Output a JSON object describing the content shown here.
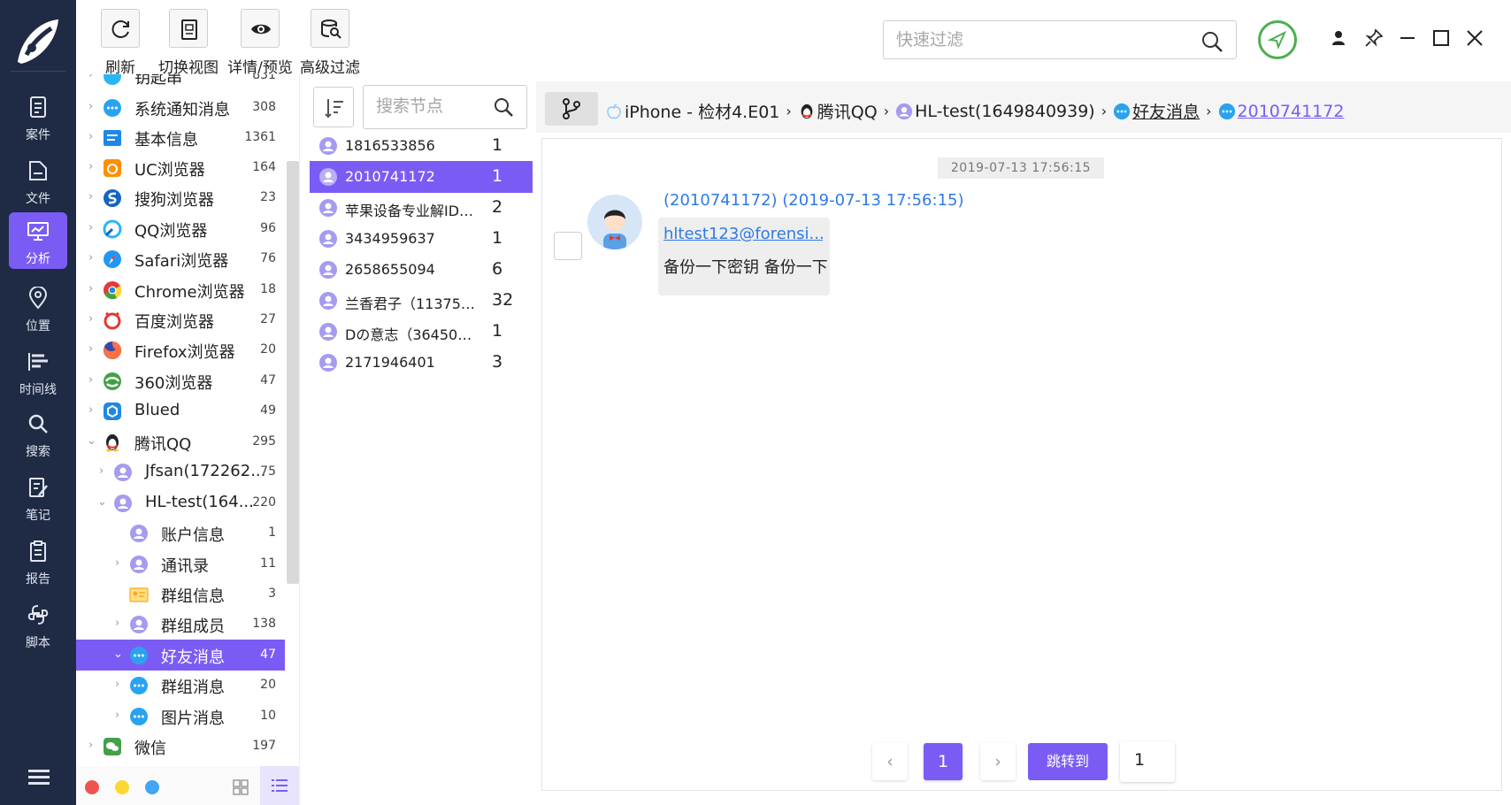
{
  "nav": [
    {
      "label": "案件",
      "icon": "case-icon"
    },
    {
      "label": "文件",
      "icon": "file-icon"
    },
    {
      "label": "分析",
      "icon": "analysis-icon",
      "active": true
    },
    {
      "label": "位置",
      "icon": "location-icon"
    },
    {
      "label": "时间线",
      "icon": "timeline-icon"
    },
    {
      "label": "搜索",
      "icon": "search-icon"
    },
    {
      "label": "笔记",
      "icon": "note-icon"
    },
    {
      "label": "报告",
      "icon": "report-icon"
    },
    {
      "label": "脚本",
      "icon": "script-icon"
    }
  ],
  "toolbar": {
    "refresh": "刷新",
    "switch_view": "切换视图",
    "details_preview": "详情/预览",
    "advanced_filter": "高级过滤"
  },
  "filter": {
    "placeholder": "快速过滤"
  },
  "tree": {
    "partial_top": {
      "name": "钥匙串",
      "count": "831"
    },
    "items": [
      {
        "name": "系统通知消息",
        "count": "308"
      },
      {
        "name": "基本信息",
        "count": "1361"
      },
      {
        "name": "UC浏览器",
        "count": "164"
      },
      {
        "name": "搜狗浏览器",
        "count": "23"
      },
      {
        "name": "QQ浏览器",
        "count": "96"
      },
      {
        "name": "Safari浏览器",
        "count": "76"
      },
      {
        "name": "Chrome浏览器",
        "count": "18"
      },
      {
        "name": "百度浏览器",
        "count": "27"
      },
      {
        "name": "Firefox浏览器",
        "count": "20"
      },
      {
        "name": "360浏览器",
        "count": "47"
      },
      {
        "name": "Blued",
        "count": "49"
      },
      {
        "name": "腾讯QQ",
        "count": "295"
      },
      {
        "name": "Jfsan(172262...",
        "count": "75"
      },
      {
        "name": "HL-test(164...",
        "count": "220"
      },
      {
        "name": "账户信息",
        "count": "1"
      },
      {
        "name": "通讯录",
        "count": "11"
      },
      {
        "name": "群组信息",
        "count": "3"
      },
      {
        "name": "群组成员",
        "count": "138"
      },
      {
        "name": "好友消息",
        "count": "47"
      },
      {
        "name": "群组消息",
        "count": "20"
      },
      {
        "name": "图片消息",
        "count": "10"
      },
      {
        "name": "微信",
        "count": "197"
      }
    ]
  },
  "node_search": {
    "placeholder": "搜索节点"
  },
  "nodes": [
    {
      "name": "1816533856",
      "count": "1"
    },
    {
      "name": "2010741172",
      "count": "1"
    },
    {
      "name": "苹果设备专业解ID（...",
      "count": "2"
    },
    {
      "name": "3434959637",
      "count": "1"
    },
    {
      "name": "2658655094",
      "count": "6"
    },
    {
      "name": "兰香君子（1137588...",
      "count": "32"
    },
    {
      "name": "Dの意志（3645052...",
      "count": "1"
    },
    {
      "name": "2171946401",
      "count": "3"
    }
  ],
  "breadcrumb": {
    "device": "iPhone - 检材4.E01",
    "app": "腾讯QQ",
    "account": "HL-test(1649840939)",
    "category": "好友消息",
    "contact": "2010741172"
  },
  "message": {
    "date": "2019-07-13 17:56:15",
    "sender": "(2010741172) (2019-07-13 17:56:15)",
    "link": "hltest123@forensi...",
    "text": "备份一下密钥 备份一下"
  },
  "pagination": {
    "current": "1",
    "jump_label": "跳转到",
    "jump_value": "1"
  },
  "colors": {
    "accent": "#7a5cf5",
    "sidebar": "#1f2a44",
    "link": "#2f7be5"
  }
}
